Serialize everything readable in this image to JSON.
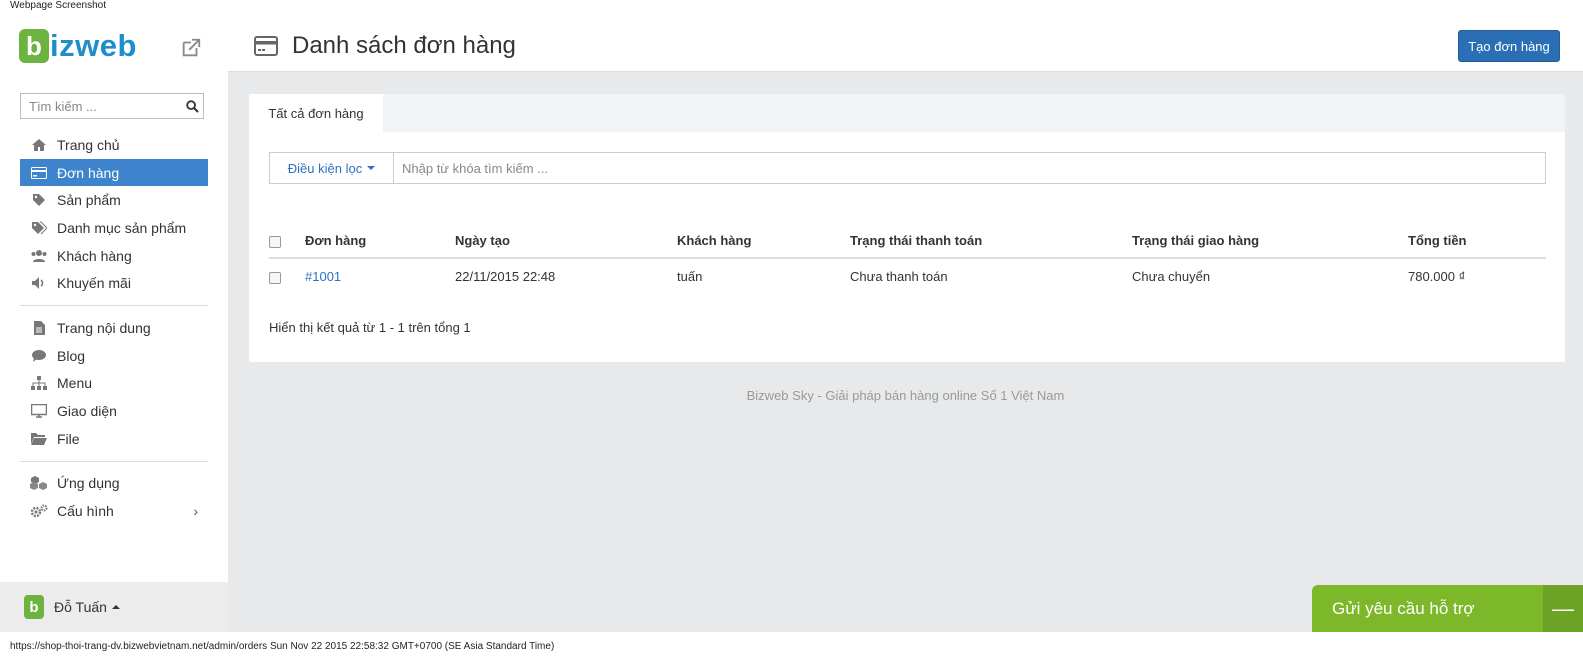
{
  "caption_top": "Webpage Screenshot",
  "caption_bottom": "https://shop-thoi-trang-dv.bizwebvietnam.net/admin/orders Sun Nov 22 2015 22:58:32 GMT+0700 (SE Asia Standard Time)",
  "brand": {
    "mark": "b",
    "text": "izweb"
  },
  "sidebar": {
    "search_placeholder": "Tìm kiếm ...",
    "items_top": [
      {
        "label": "Trang chủ",
        "icon": "home-icon"
      },
      {
        "label": "Đơn hàng",
        "icon": "credit-card-icon",
        "active": true
      },
      {
        "label": "Sản phẩm",
        "icon": "tag-icon"
      },
      {
        "label": "Danh mục sản phẩm",
        "icon": "tags-icon"
      },
      {
        "label": "Khách hàng",
        "icon": "users-icon"
      },
      {
        "label": "Khuyến mãi",
        "icon": "volume-icon"
      }
    ],
    "items_mid": [
      {
        "label": "Trang nội dung",
        "icon": "file-icon"
      },
      {
        "label": "Blog",
        "icon": "comment-icon"
      },
      {
        "label": "Menu",
        "icon": "sitemap-icon"
      },
      {
        "label": "Giao diện",
        "icon": "desktop-icon"
      },
      {
        "label": "File",
        "icon": "folder-open-icon"
      }
    ],
    "items_bottom": [
      {
        "label": "Ứng dụng",
        "icon": "cubes-icon"
      },
      {
        "label": "Cấu hình",
        "icon": "cogs-icon",
        "chevron": "›"
      }
    ],
    "user_name": "Đỗ Tuấn",
    "user_avatar": "b"
  },
  "header": {
    "title": "Danh sách đơn hàng",
    "create_button": "Tạo đơn hàng"
  },
  "tabs": {
    "all_orders": "Tất cả đơn hàng"
  },
  "filter": {
    "button_label": "Điều kiện lọc",
    "search_placeholder": "Nhập từ khóa tìm kiếm ..."
  },
  "table": {
    "headers": [
      "Đơn hàng",
      "Ngày tạo",
      "Khách hàng",
      "Trạng thái thanh toán",
      "Trạng thái giao hàng",
      "Tổng tiền"
    ],
    "rows": [
      [
        "#1001",
        "22/11/2015 22:48",
        "tuấn",
        "Chưa thanh toán",
        "Chưa chuyển",
        "780.000 ₫"
      ]
    ]
  },
  "result_text": "Hiển thị kết quả từ 1 - 1 trên tổng 1",
  "footer_text": "Bizweb Sky - Giải pháp bán hàng online Số 1 Việt Nam",
  "support": {
    "label": "Gửi yêu cầu hỗ trợ",
    "minimize": "—"
  },
  "colors": {
    "accent": "#3d84cc",
    "brand_green": "#6cb33f",
    "support_green": "#7db82a"
  }
}
